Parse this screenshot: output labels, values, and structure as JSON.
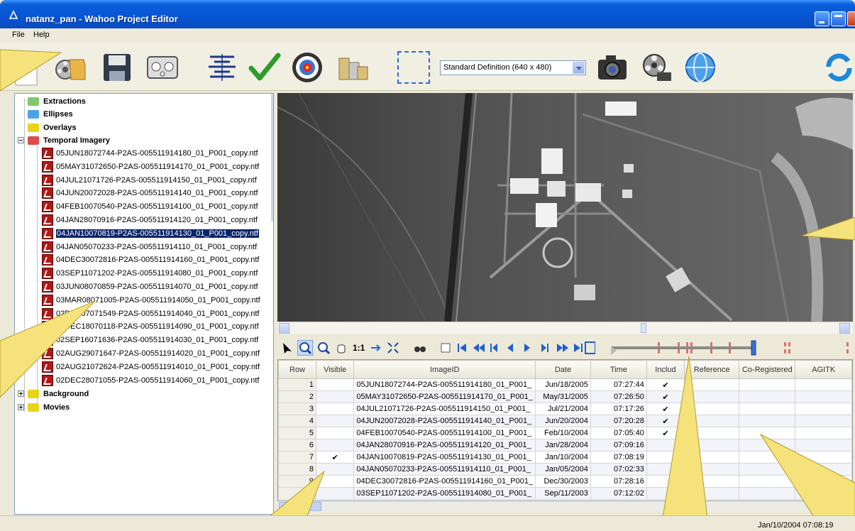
{
  "window": {
    "title": "natanz_pan - Wahoo Project Editor"
  },
  "menu": {
    "items": [
      "File",
      "Help"
    ]
  },
  "toolbar": {
    "resolution": "Standard Definition (640 x 480)",
    "icons": [
      "new-document-icon",
      "open-project-icon",
      "save-icon",
      "dashboard-icon",
      "align-icon",
      "check-icon",
      "target-icon",
      "coins-icon",
      "selection-icon",
      "camera-icon",
      "film-reel-icon",
      "globe-icon",
      "refresh-icon"
    ]
  },
  "tree": {
    "folders_top": [
      {
        "label": "Extractions",
        "color": "#7fc96b"
      },
      {
        "label": "Ellipses",
        "color": "#4aa3e8"
      },
      {
        "label": "Overlays",
        "color": "#e8d41a"
      }
    ],
    "temporal": {
      "label": "Temporal Imagery",
      "color": "#e14c4c"
    },
    "files": [
      "05JUN18072744-P2AS-005511914180_01_P001_copy.ntf",
      "05MAY31072650-P2AS-005511914170_01_P001_copy.ntf",
      "04JUL21071726-P2AS-005511914150_01_P001_copy.ntf",
      "04JUN20072028-P2AS-005511914140_01_P001_copy.ntf",
      "04FEB10070540-P2AS-005511914100_01_P001_copy.ntf",
      "04JAN28070916-P2AS-005511914120_01_P001_copy.ntf",
      "04JAN10070819-P2AS-005511914130_01_P001_copy.ntf",
      "04JAN05070233-P2AS-005511914110_01_P001_copy.ntf",
      "04DEC30072816-P2AS-005511914160_01_P001_copy.ntf",
      "03SEP11071202-P2AS-005511914080_01_P001_copy.ntf",
      "03JUN08070859-P2AS-005511914070_01_P001_copy.ntf",
      "03MAR08071005-P2AS-005511914050_01_P001_copy.ntf",
      "02DEC07071549-P2AS-005511914040_01_P001_copy.ntf",
      "03DEC18070118-P2AS-005511914090_01_P001_copy.ntf",
      "02SEP16071636-P2AS-005511914030_01_P001_copy.ntf",
      "02AUG29071647-P2AS-005511914020_01_P001_copy.ntf",
      "02AUG21072624-P2AS-005511914010_01_P001_copy.ntf",
      "02DEC28071055-P2AS-005511914060_01_P001_copy.ntf"
    ],
    "selected_index": 6,
    "folders_bottom": [
      {
        "label": "Background",
        "color": "#e8d41a"
      },
      {
        "label": "Movies",
        "color": "#e8d41a"
      }
    ]
  },
  "playback": {
    "zoom_label": "1:1"
  },
  "grid": {
    "columns": [
      "Row",
      "Visible",
      "ImageID",
      "Date",
      "Time",
      "Includ",
      "Reference",
      "Co-Registered",
      "AGITK"
    ],
    "rows": [
      {
        "row": "1",
        "visible": "",
        "id": "05JUN18072744-P2AS-005511914180_01_P001_",
        "date": "Jun/18/2005",
        "time": "07:27:44",
        "incl": "✔"
      },
      {
        "row": "2",
        "visible": "",
        "id": "05MAY31072650-P2AS-005511914170_01_P001_",
        "date": "May/31/2005",
        "time": "07:26:50",
        "incl": "✔"
      },
      {
        "row": "3",
        "visible": "",
        "id": "04JUL21071726-P2AS-005511914150_01_P001_",
        "date": "Jul/21/2004",
        "time": "07:17:26",
        "incl": "✔"
      },
      {
        "row": "4",
        "visible": "",
        "id": "04JUN20072028-P2AS-005511914140_01_P001_",
        "date": "Jun/20/2004",
        "time": "07:20:28",
        "incl": "✔"
      },
      {
        "row": "5",
        "visible": "",
        "id": "04FEB10070540-P2AS-005511914100_01_P001_",
        "date": "Feb/10/2004",
        "time": "07:05:40",
        "incl": "✔"
      },
      {
        "row": "6",
        "visible": "",
        "id": "04JAN28070916-P2AS-005511914120_01_P001_",
        "date": "Jan/28/2004",
        "time": "07:09:16",
        "incl": ""
      },
      {
        "row": "7",
        "visible": "✔",
        "id": "04JAN10070819-P2AS-005511914130_01_P001_",
        "date": "Jan/10/2004",
        "time": "07:08:19",
        "incl": ""
      },
      {
        "row": "8",
        "visible": "",
        "id": "04JAN05070233-P2AS-005511914110_01_P001_",
        "date": "Jan/05/2004",
        "time": "07:02:33",
        "incl": ""
      },
      {
        "row": "9",
        "visible": "",
        "id": "04DEC30072816-P2AS-005511914160_01_P001_",
        "date": "Dec/30/2003",
        "time": "07:28:16",
        "incl": ""
      },
      {
        "row": "10",
        "visible": "",
        "id": "03SEP11071202-P2AS-005511914080_01_P001_",
        "date": "Sep/11/2003",
        "time": "07:12:02",
        "incl": ""
      }
    ]
  },
  "status": {
    "datetime": "Jan/10/2004 07:08:19"
  },
  "colors": {
    "callout": "#f5e27a",
    "titlebar": "#0654d6",
    "selection": "#0a246a"
  }
}
